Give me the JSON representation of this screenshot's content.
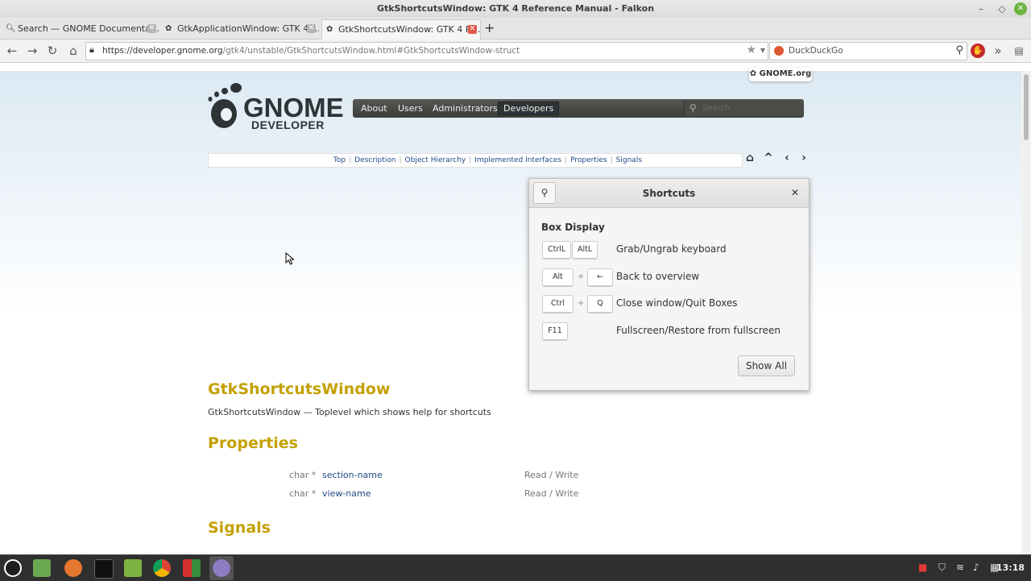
{
  "window": {
    "title": "GtkShortcutsWindow: GTK 4 Reference Manual - Falkon"
  },
  "tabs": [
    {
      "label": "Search — GNOME Documenta…",
      "active": false,
      "favicon": "search-favicon"
    },
    {
      "label": "GtkApplicationWindow: GTK 4 …",
      "active": false,
      "favicon": "gnome-foot-favicon"
    },
    {
      "label": "GtkShortcutsWindow: GTK 4 R…",
      "active": true,
      "favicon": "gnome-foot-favicon"
    }
  ],
  "navbar": {
    "url_host": "https://developer.gnome.org",
    "url_path": "/gtk4/unstable/GtkShortcutsWindow.html#GtkShortcutsWindow-struct",
    "search_placeholder": "DuckDuckGo"
  },
  "site": {
    "badge": "GNOME.org",
    "logo_word1": "GNOME",
    "logo_word2": "DEVELOPER",
    "nav_items": [
      {
        "label": "About"
      },
      {
        "label": "Users"
      },
      {
        "label": "Administrators"
      },
      {
        "label": "Developers",
        "active": true
      }
    ],
    "search_placeholder": "Search"
  },
  "section_nav": {
    "links": [
      "Top",
      "Description",
      "Object Hierarchy",
      "Implemented Interfaces",
      "Properties",
      "Signals"
    ]
  },
  "shortcuts": {
    "title": "Shortcuts",
    "group_title": "Box Display",
    "rows": [
      {
        "keys": [
          "CtrlL",
          "AltL"
        ],
        "joiner": "",
        "title": "Grab/Ungrab keyboard"
      },
      {
        "keys": [
          "Alt",
          "←"
        ],
        "joiner": "+",
        "title": "Back to overview"
      },
      {
        "keys": [
          "Ctrl",
          "Q"
        ],
        "joiner": "+",
        "title": "Close window/Quit Boxes"
      },
      {
        "keys": [
          "F11"
        ],
        "joiner": "",
        "title": "Fullscreen/Restore from fullscreen"
      }
    ],
    "show_all_label": "Show All"
  },
  "doc": {
    "title": "GtkShortcutsWindow",
    "purpose": "GtkShortcutsWindow — Toplevel which shows help for shortcuts",
    "properties_heading": "Properties",
    "properties": [
      {
        "type": "char *",
        "name": "section-name",
        "access": "Read / Write"
      },
      {
        "type": "char *",
        "name": "view-name",
        "access": "Read / Write"
      }
    ],
    "signals_heading": "Signals"
  },
  "taskbar": {
    "clock": "13:18"
  }
}
